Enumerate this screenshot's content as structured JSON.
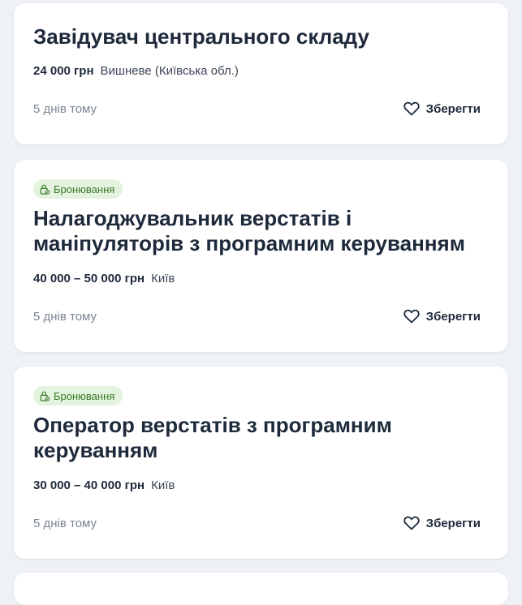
{
  "vacancies": [
    {
      "title": "Завідувач центрального складу",
      "salary": "24 000 грн",
      "location": "Вишневе (Київська обл.)",
      "posted": "5 днів тому",
      "save_label": "Зберегти",
      "badge": ""
    },
    {
      "title": "Налагоджувальник верстатів і маніпуляторів з програмним керуванням",
      "salary": "40 000 – 50 000 грн",
      "location": "Київ",
      "posted": "5 днів тому",
      "save_label": "Зберегти",
      "badge": "Бронювання"
    },
    {
      "title": "Оператор верстатів з програмним керуванням",
      "salary": "30 000 – 40 000 грн",
      "location": "Київ",
      "posted": "5 днів тому",
      "save_label": "Зберегти",
      "badge": "Бронювання"
    }
  ],
  "icons": {
    "save": "heart-icon",
    "badge": "lock-check-icon"
  },
  "colors": {
    "badge_bg": "#e3f3de",
    "badge_text": "#3b7a2a",
    "title": "#1e2a3b",
    "muted": "#7b8594"
  }
}
